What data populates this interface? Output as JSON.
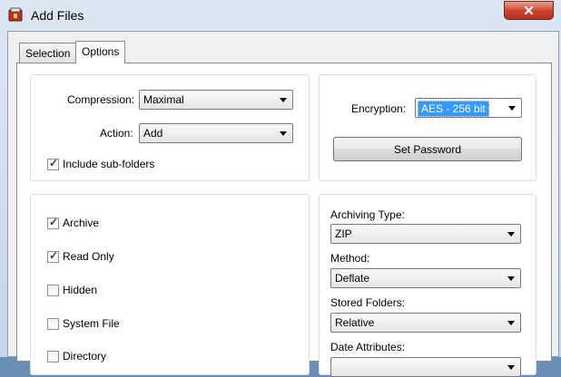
{
  "window": {
    "title": "Add Files",
    "close_label": "✕"
  },
  "tabs": [
    {
      "label": "Selection",
      "active": false
    },
    {
      "label": "Options",
      "active": true
    }
  ],
  "compression": {
    "label": "Compression:",
    "value": "Maximal"
  },
  "action": {
    "label": "Action:",
    "value": "Add"
  },
  "include_subfolders": {
    "label": "Include sub-folders",
    "checked": true
  },
  "encryption": {
    "label": "Encryption:",
    "value": "AES - 256 bit"
  },
  "set_password": {
    "label": "Set Password"
  },
  "attributes": [
    {
      "label": "Archive",
      "checked": true
    },
    {
      "label": "Read Only",
      "checked": true
    },
    {
      "label": "Hidden",
      "checked": false
    },
    {
      "label": "System File",
      "checked": false
    },
    {
      "label": "Directory",
      "checked": false
    }
  ],
  "archiving_type": {
    "label": "Archiving Type:",
    "value": "ZIP"
  },
  "method": {
    "label": "Method:",
    "value": "Deflate"
  },
  "stored_folders": {
    "label": "Stored Folders:",
    "value": "Relative"
  },
  "date_attributes": {
    "label": "Date Attributes:"
  }
}
